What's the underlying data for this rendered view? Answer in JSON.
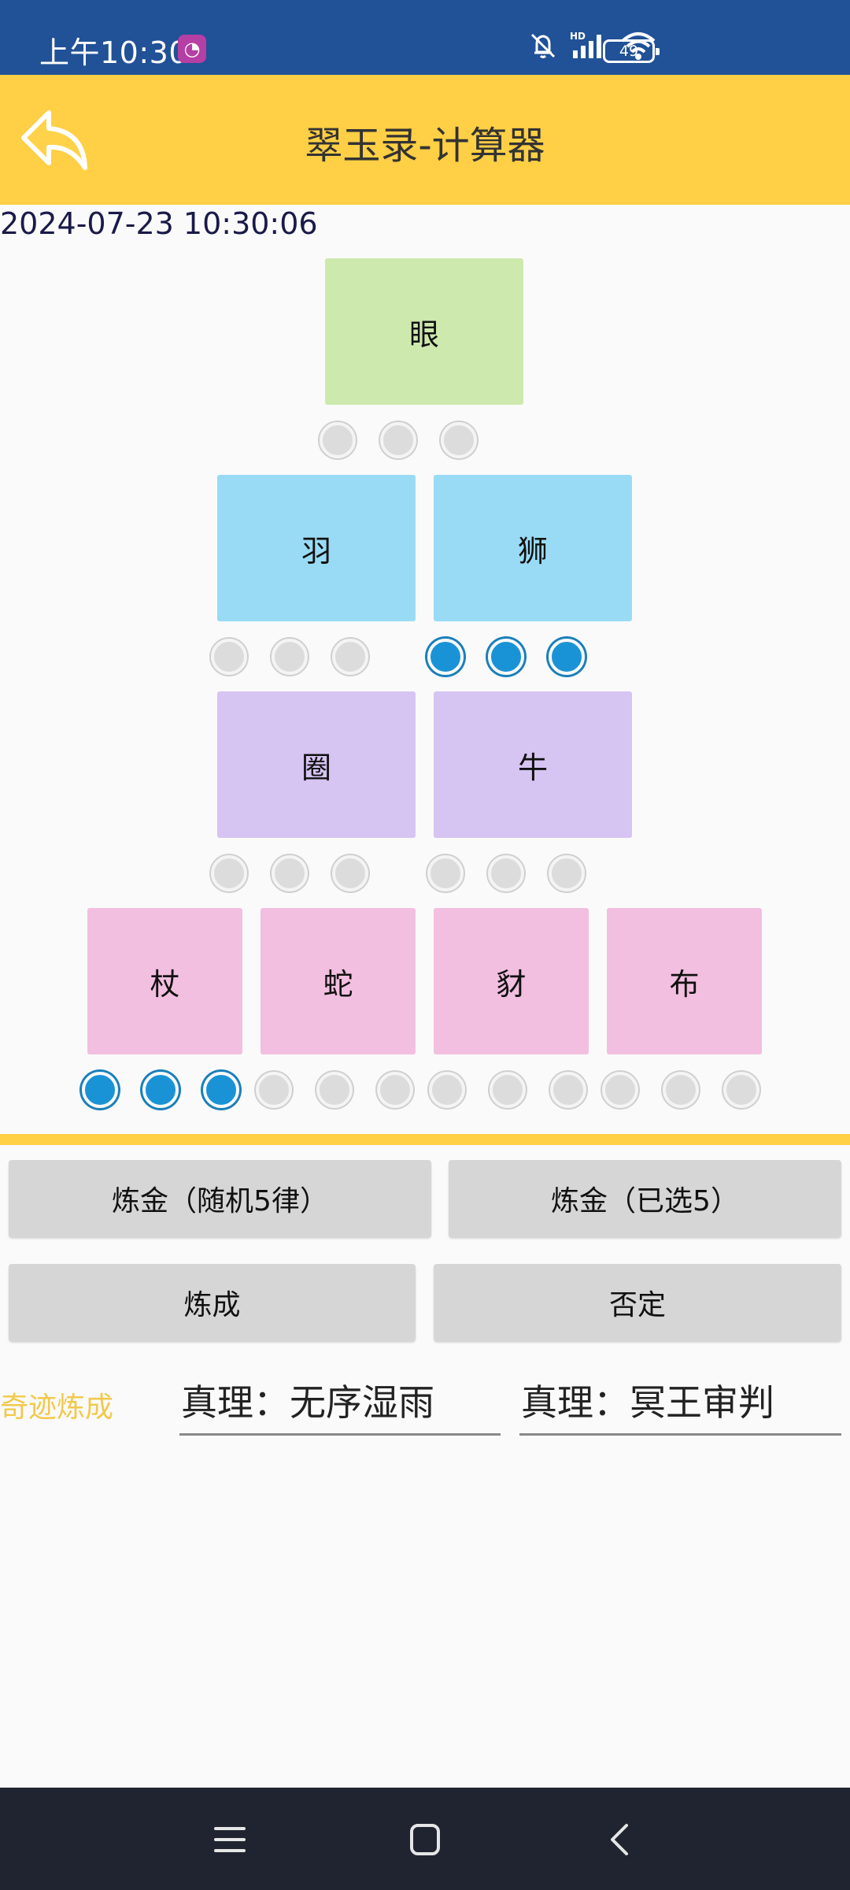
{
  "status_bar": {
    "time": "上午10:30",
    "battery": "49",
    "icons": [
      "app-notification-icon",
      "mute-bell-icon",
      "hd-signal-icon",
      "wifi-icon",
      "battery-icon"
    ]
  },
  "app_bar": {
    "title": "翠玉录-计算器",
    "back_icon": "back-arrow-icon"
  },
  "datetime": "2024-07-23 10:30:06",
  "tiles": {
    "row1": [
      "眼"
    ],
    "row2": [
      "羽",
      "狮"
    ],
    "row3": [
      "圈",
      "牛"
    ],
    "row4": [
      "杖",
      "蛇",
      "豺",
      "布"
    ]
  },
  "selection": {
    "row1": [
      false,
      false,
      false
    ],
    "row2": [
      false,
      false,
      false,
      true,
      true,
      true
    ],
    "row3": [
      false,
      false,
      false,
      false,
      false,
      false
    ],
    "row4": [
      true,
      true,
      true,
      false,
      false,
      false,
      false,
      false,
      false,
      false,
      false,
      false
    ]
  },
  "colors": {
    "status_bar": "#215197",
    "accent": "#ffcf45",
    "tile_green": "#cde9ad",
    "tile_blue": "#99dbf5",
    "tile_purple": "#d6c4f2",
    "tile_pink": "#f2bfe0",
    "dot_selected": "#1a93d6"
  },
  "buttons": {
    "alchemy_random": "炼金（随机5律）",
    "alchemy_selected": "炼金（已选5）",
    "complete": "炼成",
    "deny": "否定"
  },
  "miracle": {
    "label": "奇迹炼成",
    "truth_1": "真理：无序湿雨",
    "truth_2": "真理：冥王审判"
  },
  "nav_bar": {
    "icons": [
      "menu-icon",
      "home-icon",
      "back-icon"
    ]
  }
}
